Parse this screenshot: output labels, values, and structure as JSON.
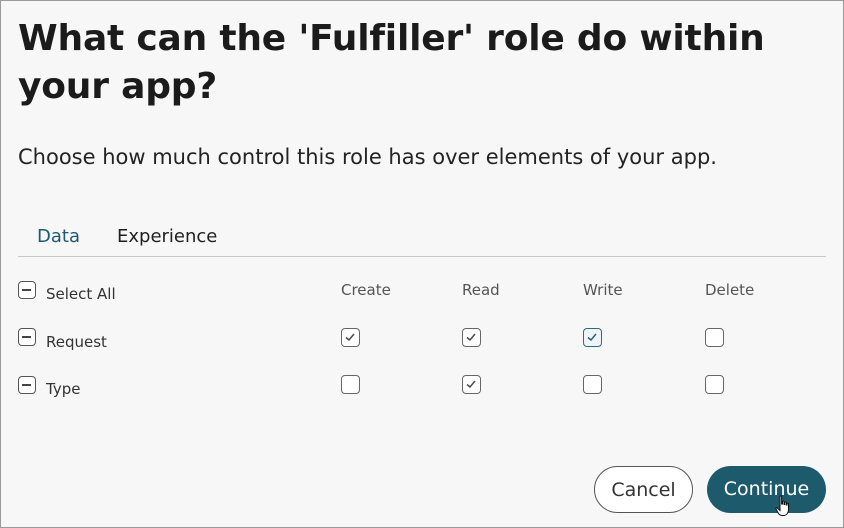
{
  "dialog": {
    "title": "What can the 'Fulfiller' role do within your app?",
    "subtitle": "Choose how much control this role has over elements of your app."
  },
  "tabs": [
    {
      "label": "Data",
      "active": true
    },
    {
      "label": "Experience",
      "active": false
    }
  ],
  "permissions": {
    "select_all_label": "Select All",
    "columns": [
      "Create",
      "Read",
      "Write",
      "Delete"
    ],
    "rows": [
      {
        "label": "Request",
        "values": [
          true,
          true,
          true,
          false
        ]
      },
      {
        "label": "Type",
        "values": [
          false,
          true,
          false,
          false
        ]
      }
    ]
  },
  "buttons": {
    "cancel": "Cancel",
    "continue": "Continue"
  },
  "colors": {
    "accent": "#1d5a6b",
    "tab_active": "#1d5a72"
  },
  "icons": {
    "checkbox_check": "check-icon",
    "row_toggle": "indeterminate-icon",
    "cursor": "hand-pointer-icon"
  }
}
